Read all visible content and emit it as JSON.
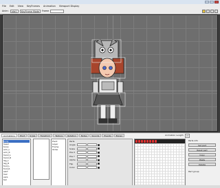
{
  "window": {
    "title": ""
  },
  "menu": [
    "File",
    "Edit",
    "View",
    "KeyFrames",
    "Animation",
    "Viewport Display"
  ],
  "toolbar": {
    "animation_label": "Anim:",
    "animation_value": "idle1",
    "keyframe_mode": "KeyFrame Mode",
    "frame_label": "Frame"
  },
  "bottom_tabs": [
    "Animations",
    "Pivot",
    "Scale",
    "Transform",
    "Texture",
    "Rotation",
    "Notes",
    "Sounds",
    "Events",
    "Bones"
  ],
  "tree_items": [
    "body",
    "head",
    "torso",
    "arm_L",
    "arm_R",
    "hand_L",
    "hand_R",
    "leg_L",
    "leg_R",
    "foot_L",
    "foot_R",
    "skirt",
    "hair",
    "ears",
    "tail"
  ],
  "tree_selected_index": 0,
  "list3_items": [
    "Pivot",
    "Layer",
    "Frame",
    "Order"
  ],
  "params_title": "Parts",
  "param_rows": [
    "Angle",
    "Scale",
    "Pos X",
    "Pos Y",
    "Alpha",
    "Flip",
    "Color"
  ],
  "anim_length": {
    "label": "Animation Length",
    "value": "24"
  },
  "right_panel": {
    "title": "Parts info",
    "buttons": [
      "Set part",
      "Reset part",
      "Copy",
      "Paste",
      "Delete"
    ],
    "part_group": "Part group"
  }
}
